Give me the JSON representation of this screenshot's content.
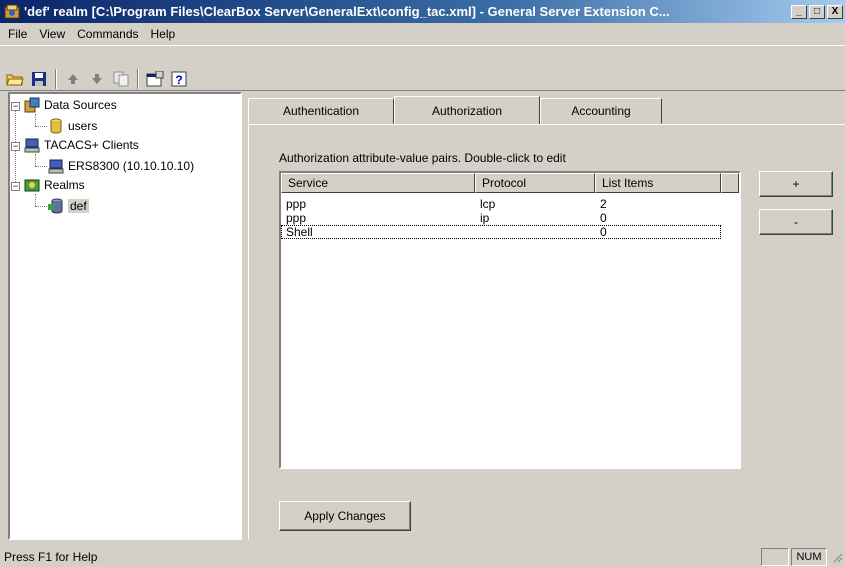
{
  "window": {
    "title": "'def' realm [C:\\Program Files\\ClearBox Server\\GeneralExt\\config_tac.xml] - General Server Extension C...",
    "controls": {
      "minimize": "_",
      "maximize": "□",
      "close": "X"
    }
  },
  "menu": [
    "File",
    "View",
    "Commands",
    "Help"
  ],
  "toolbar": {
    "icons": [
      "open-folder-icon",
      "save-icon",
      "move-up-icon",
      "move-down-icon",
      "copy-icon",
      "properties-icon",
      "help-icon"
    ]
  },
  "tree": {
    "data_sources": "Data Sources",
    "users": "users",
    "tacacs_clients": "TACACS+ Clients",
    "client1": "ERS8300 (10.10.10.10)",
    "realms": "Realms",
    "def": "def"
  },
  "tabs": [
    "Authentication",
    "Authorization",
    "Accounting"
  ],
  "active_tab": "Authorization",
  "authorization": {
    "caption": "Authorization attribute-value pairs. Double-click to edit",
    "columns": [
      "Service",
      "Protocol",
      "List Items"
    ],
    "rows": [
      {
        "service": "ppp",
        "protocol": "lcp",
        "items": "2"
      },
      {
        "service": "ppp",
        "protocol": "ip",
        "items": "0"
      },
      {
        "service": "Shell",
        "protocol": "",
        "items": "0"
      }
    ],
    "add_label": "+",
    "remove_label": "-",
    "apply_label": "Apply Changes"
  },
  "status": {
    "help": "Press F1 for Help",
    "num": "NUM"
  }
}
